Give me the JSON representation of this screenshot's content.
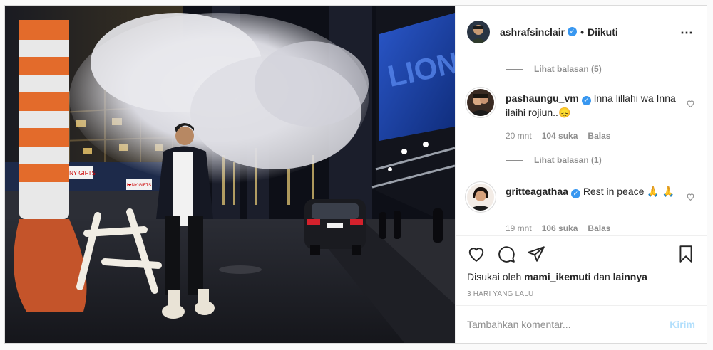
{
  "header": {
    "username": "ashrafsinclair",
    "separator": "•",
    "follow_status": "Diikuti",
    "more_icon": "⋯"
  },
  "comments": [
    {
      "type": "replies",
      "label": "Lihat balasan (5)"
    },
    {
      "type": "comment",
      "username": "pashaungu_vm",
      "text": "Inna lillahi wa Inna ilaihi rojiun..",
      "emoji": "😞",
      "time": "20 mnt",
      "likes": "104 suka",
      "reply": "Balas"
    },
    {
      "type": "replies",
      "label": "Lihat balasan (1)"
    },
    {
      "type": "comment",
      "username": "gritteagathaa",
      "text": "Rest in peace",
      "emoji": "🙏",
      "emoji2": "🙏",
      "time": "19 mnt",
      "likes": "106 suka",
      "reply": "Balas"
    }
  ],
  "actions": {
    "liked_by_prefix": "Disukai oleh",
    "liked_by_user": "mami_ikemuti",
    "liked_by_and": "dan",
    "liked_by_others": "lainnya",
    "timestamp": "3 HARI YANG LALU"
  },
  "add_comment": {
    "placeholder": "Tambahkan komentar...",
    "post_label": "Kirim"
  },
  "colors": {
    "verified": "#3897f0",
    "post_button_disabled": "#b2dffc",
    "secondary_text": "#8e8e8e"
  },
  "photo_signs": {
    "left_sign": "I❤NY GIFTS",
    "right_sign": "I❤NY GIFTS"
  }
}
